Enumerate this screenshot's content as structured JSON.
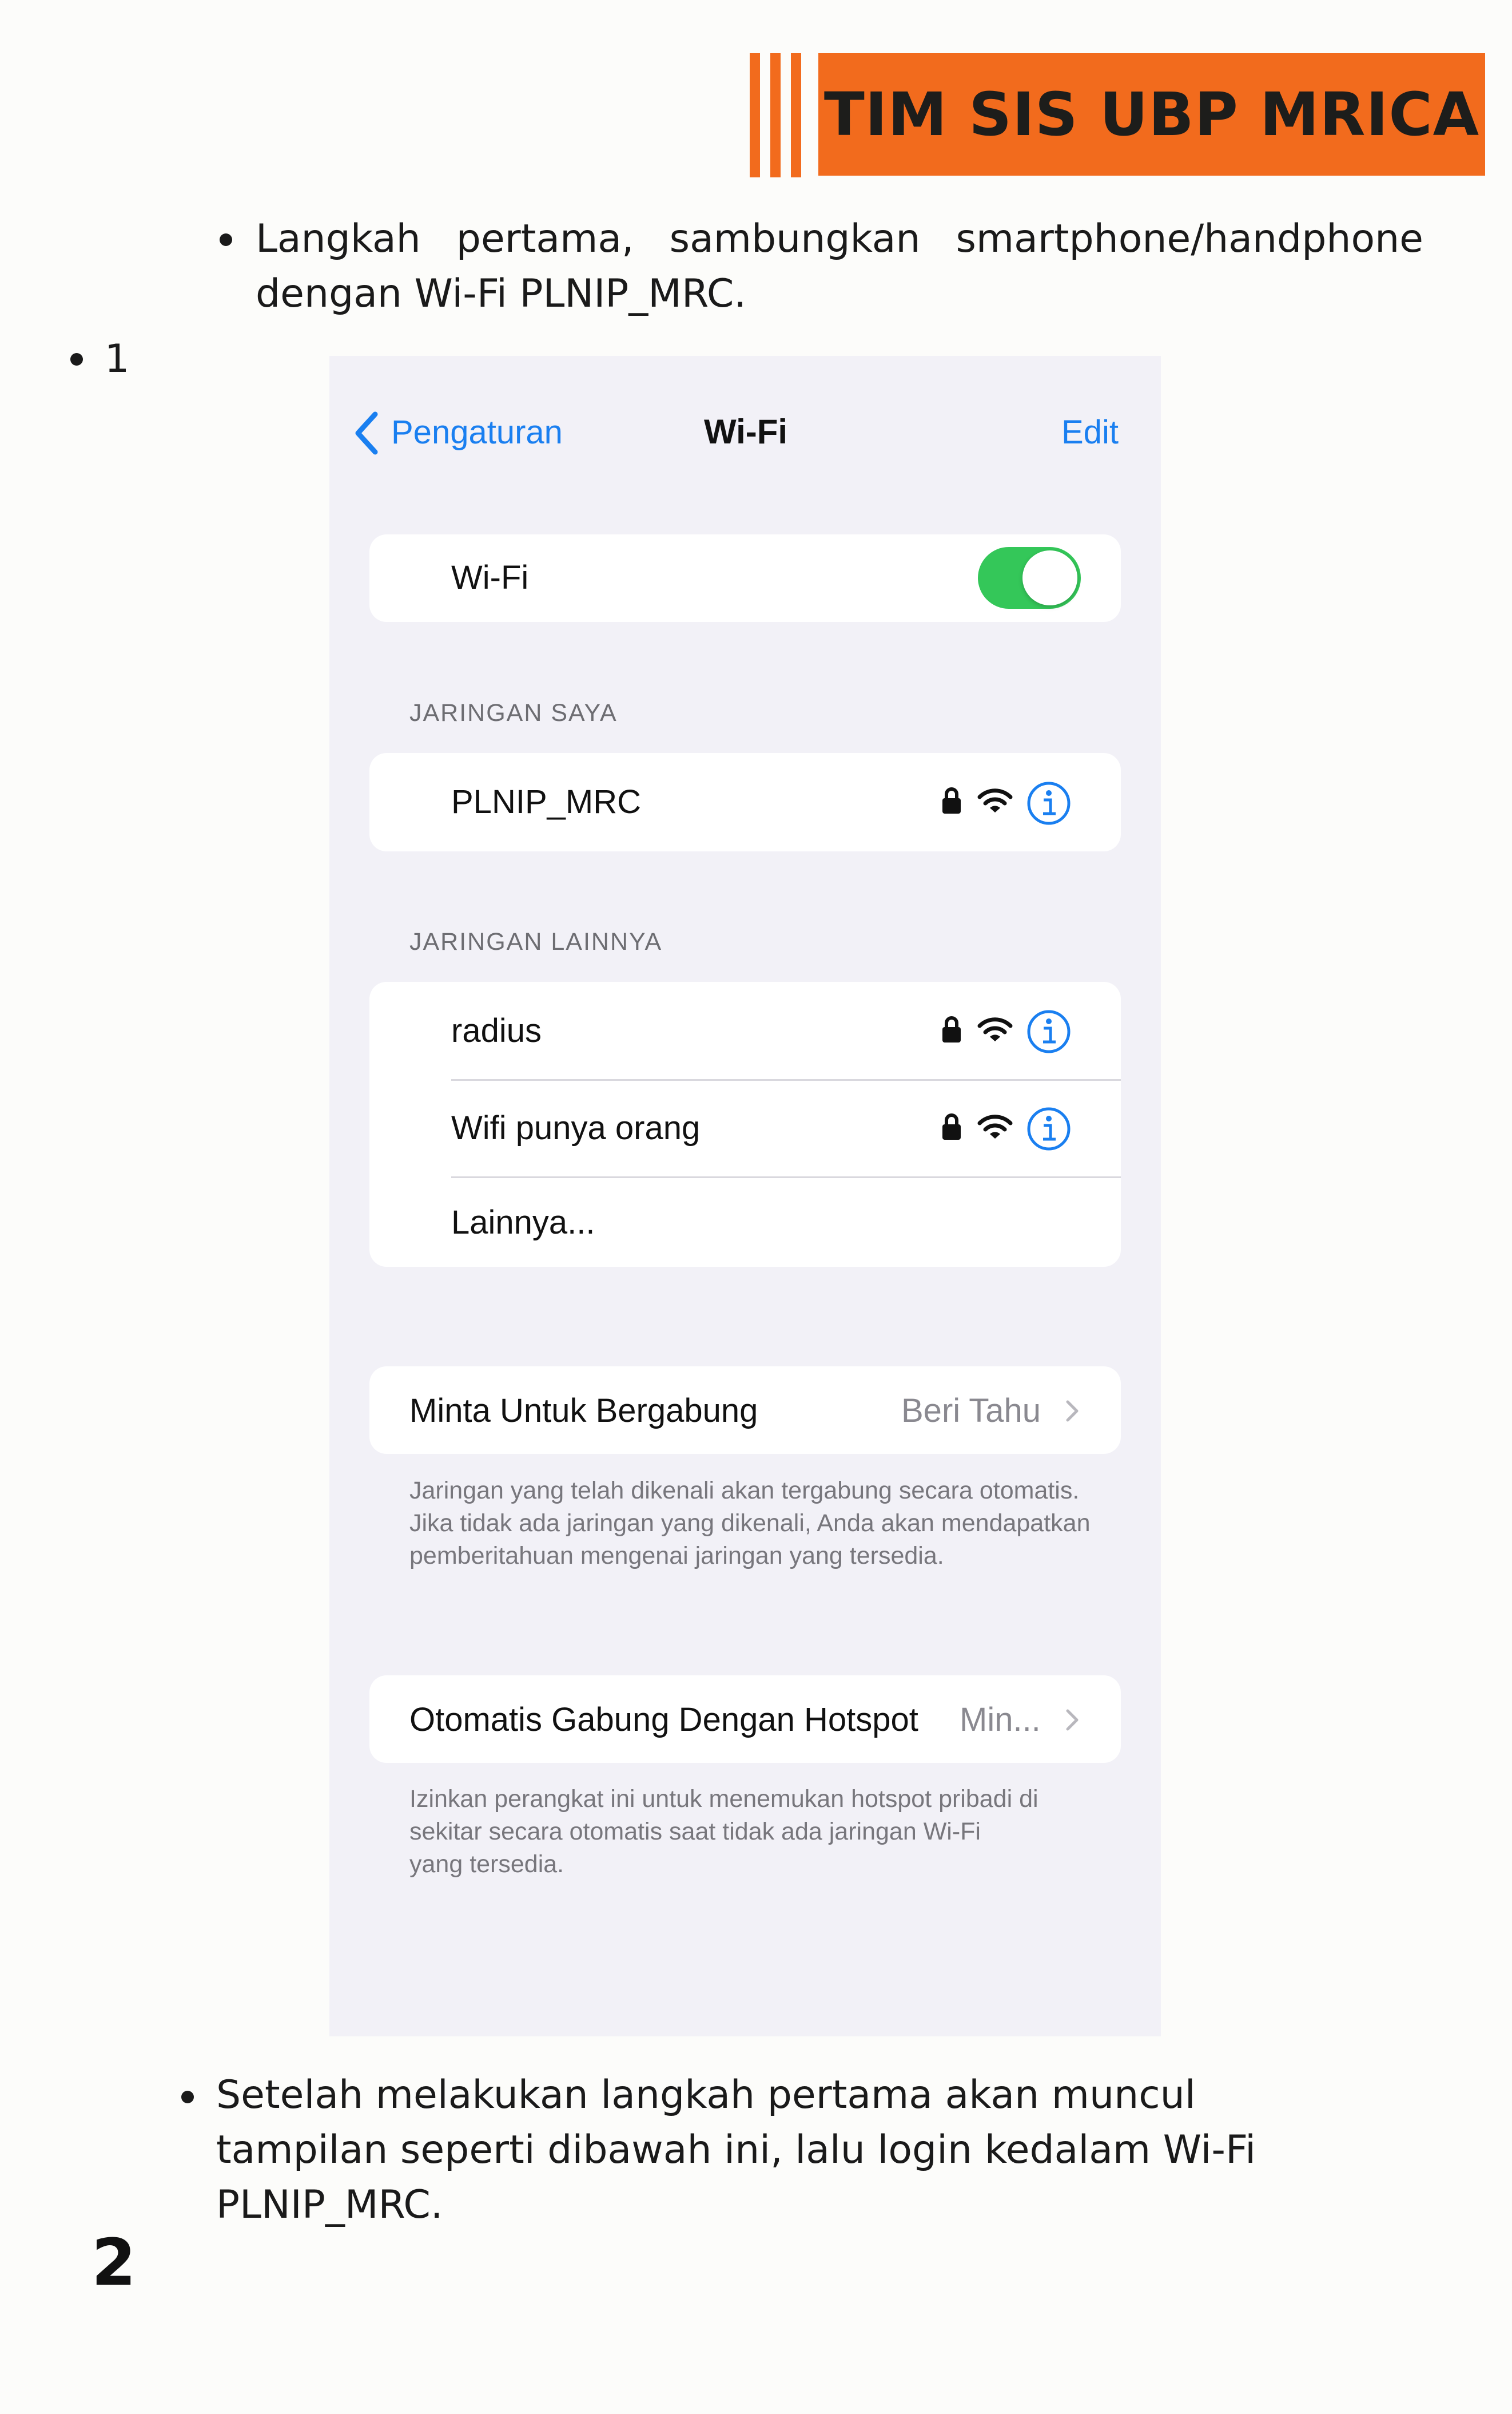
{
  "header": {
    "title": "TIM SIS UBP MRICA"
  },
  "step1": {
    "text": "Langkah pertama, sambungkan smartphone/handphone dengan Wi-Fi PLNIP_MRC."
  },
  "list_marker": {
    "label": "1"
  },
  "screenshot": {
    "nav": {
      "back_label": "Pengaturan",
      "title": "Wi-Fi",
      "edit_label": "Edit"
    },
    "wifi_toggle": {
      "label": "Wi-Fi",
      "state": "on"
    },
    "my_networks": {
      "header": "JARINGAN SAYA",
      "items": [
        {
          "name": "PLNIP_MRC"
        }
      ]
    },
    "other_networks": {
      "header": "JARINGAN LAINNYA",
      "items": [
        {
          "name": "radius"
        },
        {
          "name": "Wifi punya orang"
        }
      ],
      "other_label": "Lainnya..."
    },
    "ask_to_join": {
      "label": "Minta Untuk Bergabung",
      "value": "Beri Tahu",
      "description": "Jaringan yang telah dikenali akan tergabung secara otomatis. Jika tidak ada jaringan yang dikenali, Anda akan mendapatkan pemberitahuan mengenai jaringan yang tersedia."
    },
    "auto_join_hotspot": {
      "label": "Otomatis Gabung Dengan Hotspot",
      "value": "Min...",
      "description": "Izinkan perangkat ini untuk menemukan hotspot pribadi di sekitar secara otomatis saat tidak ada jaringan Wi-Fi yang tersedia."
    },
    "colors": {
      "accent": "#1a7ff0",
      "toggle_on": "#34c759",
      "background": "#f2f1f7"
    },
    "icons": [
      "chevron-left-icon",
      "lock-icon",
      "wifi-icon",
      "info-icon",
      "chevron-right-icon"
    ]
  },
  "step2": {
    "text": "Setelah melakukan langkah pertama akan muncul tampilan seperti dibawah ini, lalu login kedalam Wi-Fi PLNIP_MRC."
  },
  "page_number": "2",
  "brand_colors": {
    "orange": "#f26b1d"
  }
}
